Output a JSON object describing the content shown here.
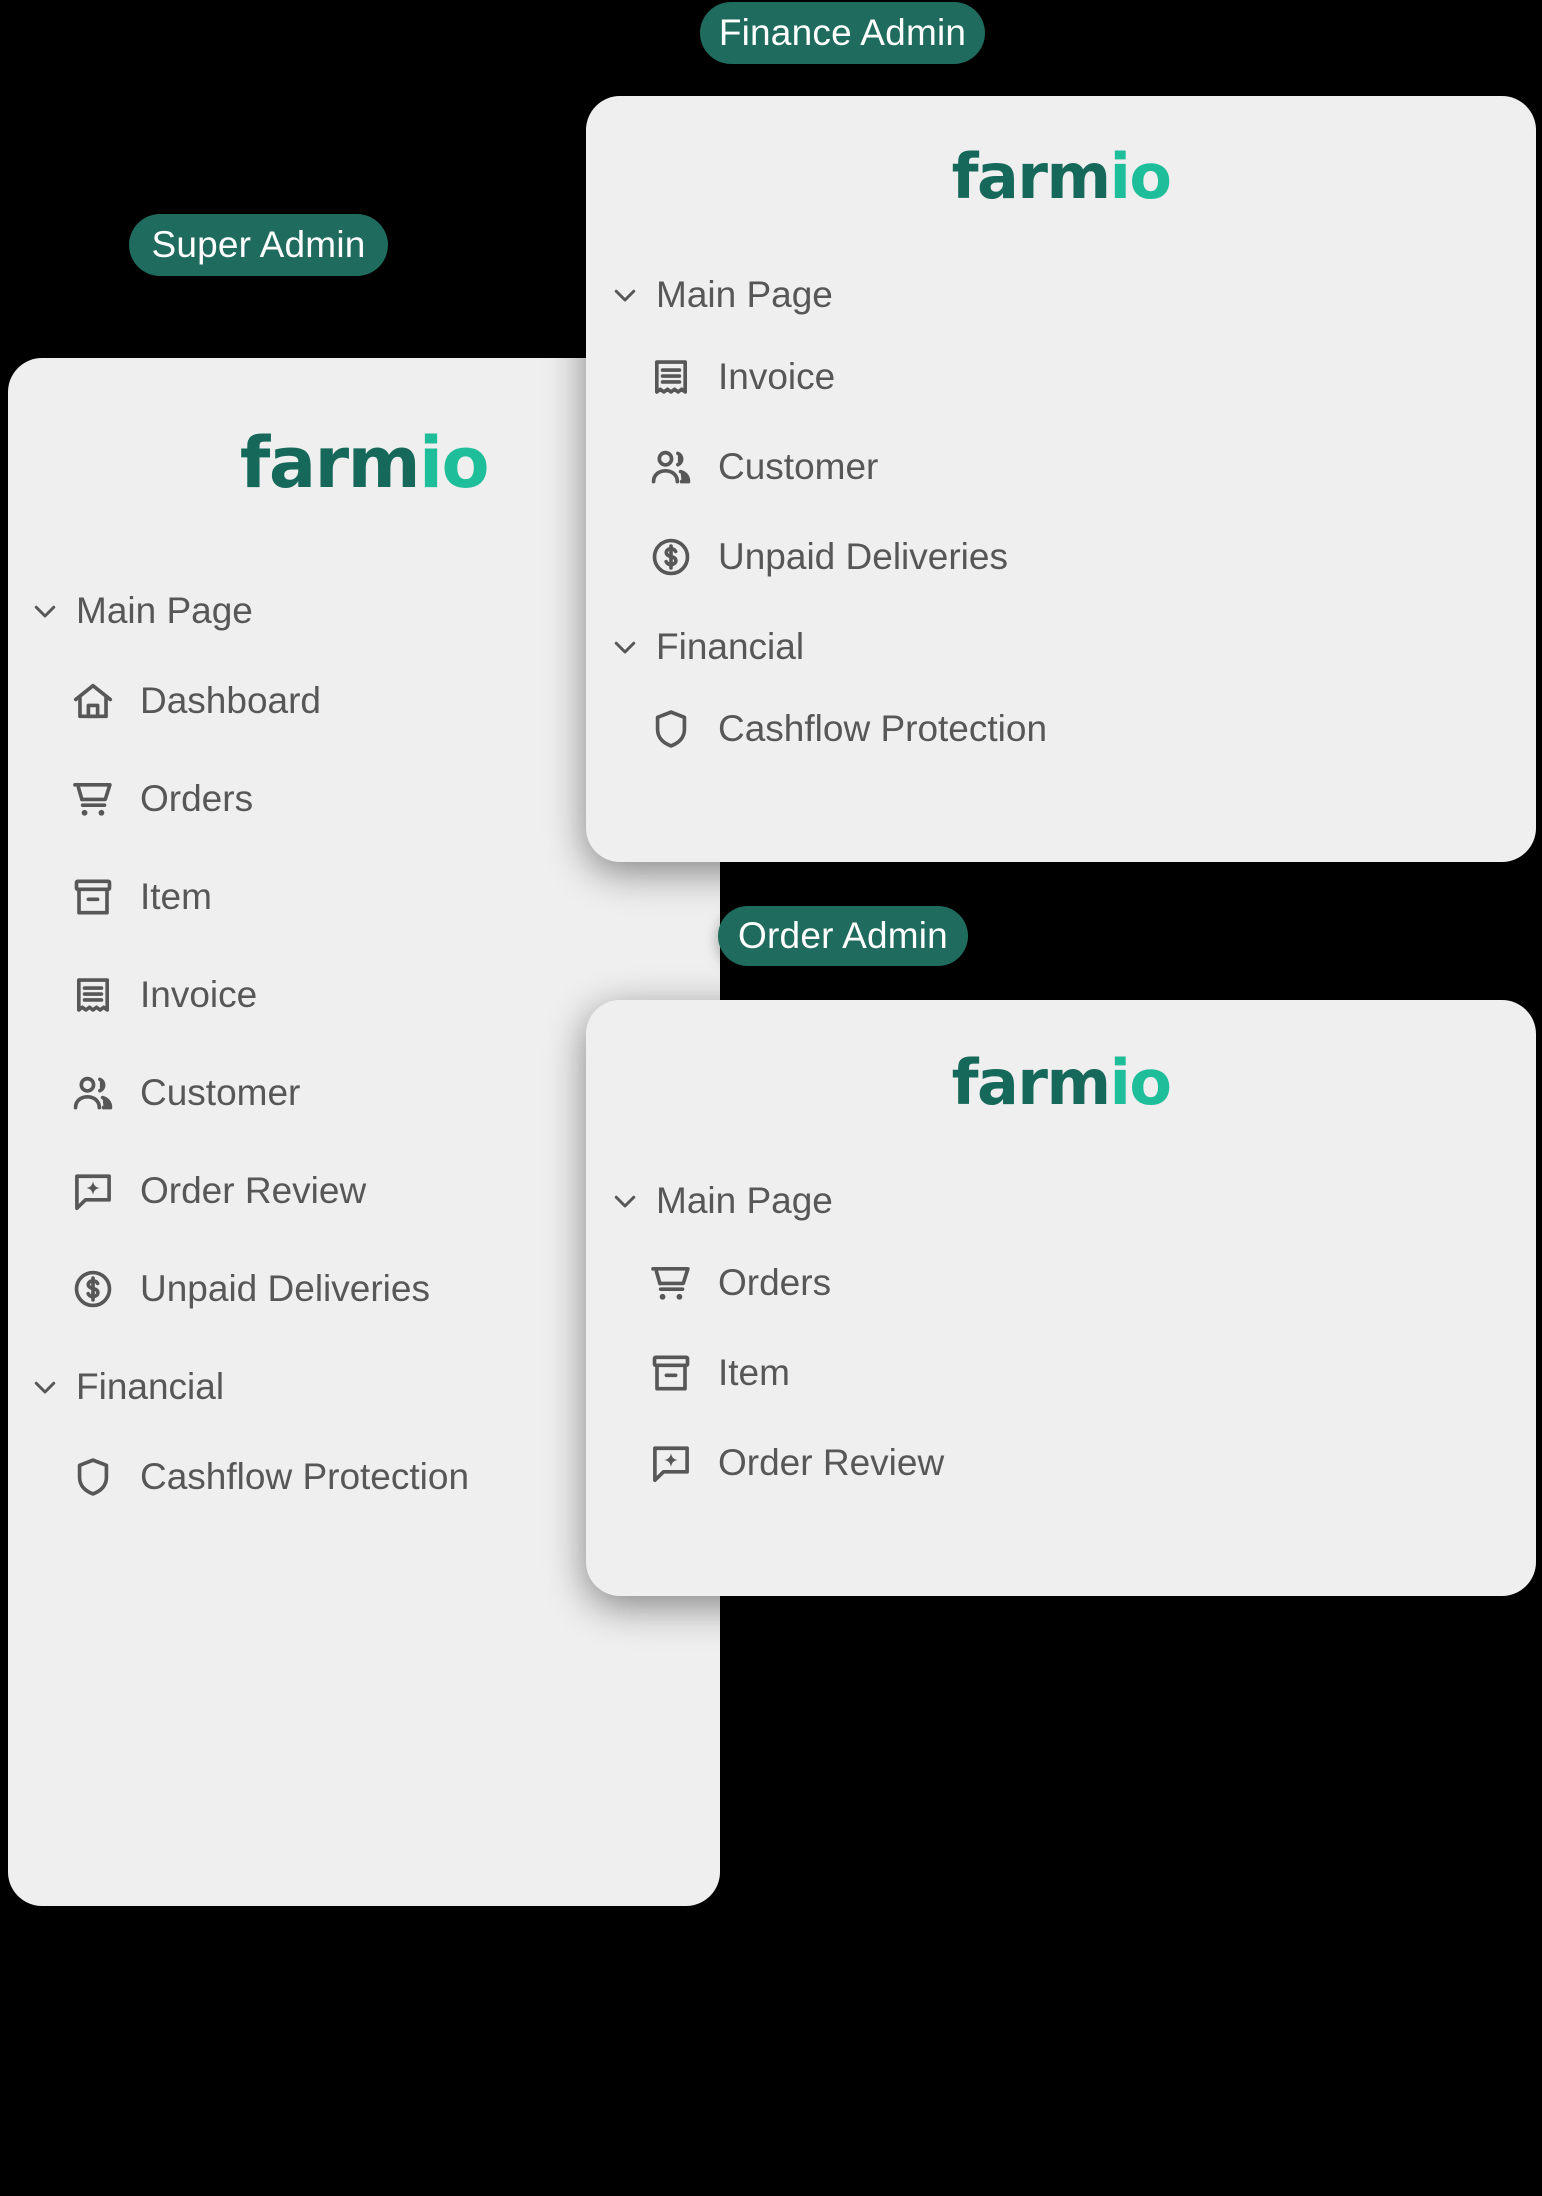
{
  "brand": {
    "logo_primary_text": "farm",
    "logo_accent_text": "io",
    "logo_primary_color": "#16685A",
    "logo_accent_color": "#1FBE9B",
    "badge_bg_color": "#1F6B5D",
    "badge_text_color": "#FFFFFF",
    "panel_bg_color": "#EFEFEF",
    "menu_text_color": "#575757",
    "page_bg_color": "#000000"
  },
  "panels": [
    {
      "id": "super",
      "badge_label": "Super Admin",
      "groups": [
        {
          "label": "Main Page",
          "chevron_icon": "chevron-down-icon",
          "items": [
            {
              "label": "Dashboard",
              "icon": "home-icon"
            },
            {
              "label": "Orders",
              "icon": "shopping-cart-icon"
            },
            {
              "label": "Item",
              "icon": "box-archive-icon"
            },
            {
              "label": "Invoice",
              "icon": "receipt-icon"
            },
            {
              "label": "Customer",
              "icon": "people-icon"
            },
            {
              "label": "Order Review",
              "icon": "chat-sparkle-icon"
            },
            {
              "label": "Unpaid Deliveries",
              "icon": "dollar-circle-icon"
            }
          ]
        },
        {
          "label": "Financial",
          "chevron_icon": "chevron-down-icon",
          "items": [
            {
              "label": "Cashflow Protection",
              "icon": "shield-icon"
            }
          ]
        }
      ]
    },
    {
      "id": "finance",
      "badge_label": "Finance Admin",
      "groups": [
        {
          "label": "Main Page",
          "chevron_icon": "chevron-down-icon",
          "items": [
            {
              "label": "Invoice",
              "icon": "receipt-icon"
            },
            {
              "label": "Customer",
              "icon": "people-icon"
            },
            {
              "label": "Unpaid Deliveries",
              "icon": "dollar-circle-icon"
            }
          ]
        },
        {
          "label": "Financial",
          "chevron_icon": "chevron-down-icon",
          "items": [
            {
              "label": "Cashflow Protection",
              "icon": "shield-icon"
            }
          ]
        }
      ]
    },
    {
      "id": "order",
      "badge_label": "Order Admin",
      "groups": [
        {
          "label": "Main Page",
          "chevron_icon": "chevron-down-icon",
          "items": [
            {
              "label": "Orders",
              "icon": "shopping-cart-icon"
            },
            {
              "label": "Item",
              "icon": "box-archive-icon"
            },
            {
              "label": "Order Review",
              "icon": "chat-sparkle-icon"
            }
          ]
        }
      ]
    }
  ]
}
